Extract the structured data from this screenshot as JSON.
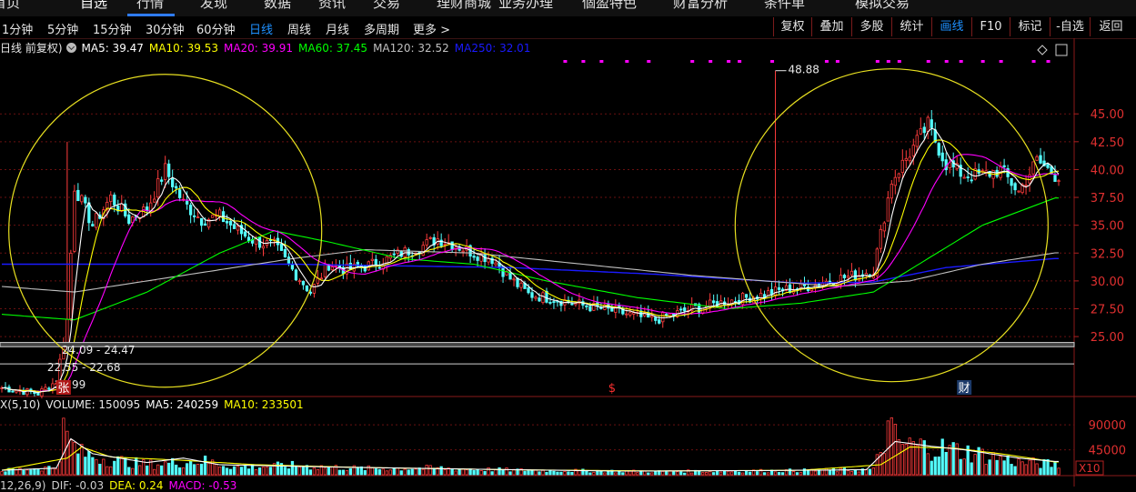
{
  "top_nav": {
    "items": [
      {
        "label": "首页",
        "active": false
      },
      {
        "label": "自选",
        "active": true
      },
      {
        "label": "行情",
        "active": false
      },
      {
        "label": "发现",
        "active": false
      },
      {
        "label": "数据",
        "active": false
      },
      {
        "label": "资讯",
        "active": false
      },
      {
        "label": "交易",
        "active": false
      },
      {
        "label": "理财商城",
        "active": false
      },
      {
        "label": "业务办理",
        "active": false
      },
      {
        "label": "個盈特色",
        "active": false
      },
      {
        "label": "财富分析",
        "active": false
      },
      {
        "label": "条件单",
        "active": false
      },
      {
        "label": "模拟交易",
        "active": false
      }
    ]
  },
  "toolbar": {
    "periods": [
      {
        "label": "1分钟",
        "active": false
      },
      {
        "label": "5分钟",
        "active": false
      },
      {
        "label": "15分钟",
        "active": false
      },
      {
        "label": "30分钟",
        "active": false
      },
      {
        "label": "60分钟",
        "active": false
      },
      {
        "label": "日线",
        "active": true
      },
      {
        "label": "周线",
        "active": false
      },
      {
        "label": "月线",
        "active": false
      },
      {
        "label": "多周期",
        "active": false
      },
      {
        "label": "更多 >",
        "active": false
      }
    ],
    "buttons": [
      {
        "label": "复权",
        "active": false
      },
      {
        "label": "叠加",
        "active": false
      },
      {
        "label": "多股",
        "active": false
      },
      {
        "label": "统计",
        "active": false
      },
      {
        "label": "画线",
        "active": true
      },
      {
        "label": "F10",
        "active": false
      },
      {
        "label": "标记",
        "active": false
      },
      {
        "label": "-自选",
        "active": false
      },
      {
        "label": "返回",
        "active": false
      }
    ]
  },
  "legend": {
    "kline_label": "日线 前复权)",
    "ma5": "MA5: 39.47",
    "ma10": "MA10: 39.53",
    "ma20": "MA20: 39.91",
    "ma60": "MA60: 37.45",
    "ma120": "MA120: 32.52",
    "ma250": "MA250: 32.01"
  },
  "volume_legend": {
    "name": "X(5,10)",
    "volume": "VOLUME: 150095",
    "ma5": "MA5: 240259",
    "ma10": "MA10: 233501"
  },
  "macd_legend": {
    "name": "12,26,9)",
    "dif": "DIF: -0.03",
    "dea": "DEA: 0.24",
    "macd": "MACD: -0.53"
  },
  "colors": {
    "up": "#ff3c3c",
    "down": "#54ffff",
    "ma5": "#ffffff",
    "ma10": "#ffff00",
    "ma20": "#ff00ff",
    "ma60": "#00ff00",
    "ma120": "#c0c0c0",
    "ma250": "#1a1aff",
    "grid": "#6a1010",
    "circle": "#e8e020",
    "axis_text": "#e03030"
  },
  "chart_data": [
    {
      "type": "candlestick",
      "title": "日线",
      "y_ticks": [
        25.0,
        27.5,
        30.0,
        32.5,
        35.0,
        37.5,
        40.0,
        42.5,
        45.0
      ],
      "y_tick_labels": [
        "25.00",
        "27.50",
        "30.00",
        "32.50",
        "35.00",
        "37.50",
        "40.00",
        "42.50",
        "45.00"
      ],
      "ylim": [
        19.7,
        50.0
      ],
      "grid": true,
      "price_annotations": [
        {
          "label": "48.88",
          "x_index": 213,
          "price": 48.88
        },
        {
          "label": "24.09 - 24.47",
          "x_index": 18,
          "price": 24.09
        },
        {
          "label": "22.55 - 22.68",
          "x_index": 14,
          "price": 22.55
        },
        {
          "label": "20.99",
          "x_index": 16,
          "price": 20.99
        }
      ],
      "horizontal_bands": [
        24.09,
        24.47,
        22.55
      ],
      "event_markers": [
        {
          "label": "张",
          "x_index": 17
        },
        {
          "label": "$",
          "x_index": 168
        },
        {
          "label": "财",
          "x_index": 265
        }
      ],
      "signal_dots_x": [
        155,
        160,
        165,
        172,
        178,
        190,
        195,
        200,
        203,
        212,
        227,
        230,
        241,
        244,
        247,
        255,
        260,
        264,
        270,
        275,
        284,
        288
      ],
      "highlight_circles": [
        {
          "center_x_index": 45,
          "center_price": 34.5
        },
        {
          "center_x_index": 245,
          "center_price": 35.0
        }
      ],
      "keypoints": [
        [
          0,
          20.4
        ],
        [
          10,
          19.9
        ],
        [
          15,
          20.99
        ],
        [
          18,
          26.5
        ],
        [
          20,
          38.5
        ],
        [
          25,
          35.0
        ],
        [
          30,
          37.5
        ],
        [
          35,
          35.5
        ],
        [
          40,
          36.5
        ],
        [
          45,
          40.0
        ],
        [
          50,
          37.0
        ],
        [
          55,
          35.5
        ],
        [
          60,
          35.8
        ],
        [
          65,
          34.5
        ],
        [
          70,
          33.5
        ],
        [
          75,
          33.2
        ],
        [
          80,
          31.0
        ],
        [
          85,
          29.0
        ],
        [
          90,
          31.5
        ],
        [
          95,
          31.0
        ],
        [
          100,
          31.3
        ],
        [
          105,
          31.8
        ],
        [
          110,
          32.5
        ],
        [
          115,
          33.0
        ],
        [
          120,
          33.8
        ],
        [
          125,
          33.2
        ],
        [
          130,
          32.5
        ],
        [
          135,
          32.0
        ],
        [
          140,
          30.2
        ],
        [
          145,
          28.8
        ],
        [
          150,
          28.5
        ],
        [
          155,
          28.2
        ],
        [
          160,
          27.8
        ],
        [
          165,
          27.5
        ],
        [
          170,
          27.2
        ],
        [
          175,
          26.8
        ],
        [
          180,
          26.5
        ],
        [
          185,
          27.0
        ],
        [
          190,
          27.5
        ],
        [
          195,
          27.8
        ],
        [
          200,
          28.2
        ],
        [
          205,
          28.5
        ],
        [
          210,
          28.8
        ],
        [
          215,
          29.2
        ],
        [
          220,
          29.4
        ],
        [
          225,
          29.8
        ],
        [
          230,
          30.2
        ],
        [
          235,
          30.5
        ],
        [
          240,
          31.0
        ],
        [
          245,
          39.0
        ],
        [
          250,
          41.5
        ],
        [
          255,
          44.0
        ],
        [
          260,
          40.5
        ],
        [
          265,
          39.5
        ],
        [
          270,
          39.5
        ],
        [
          275,
          40.0
        ],
        [
          280,
          38.0
        ],
        [
          285,
          40.8
        ],
        [
          290,
          39.5
        ]
      ],
      "moving_averages": {
        "ma5": "MA5: 39.47",
        "ma10": "MA10: 39.53",
        "ma20": "MA20: 39.91",
        "ma60": "MA60: 37.45",
        "ma120": "MA120: 32.52",
        "ma250": "MA250: 32.01",
        "ma60_keypoints": [
          [
            0,
            27.0
          ],
          [
            20,
            26.5
          ],
          [
            40,
            29.0
          ],
          [
            60,
            32.5
          ],
          [
            75,
            34.5
          ],
          [
            90,
            33.5
          ],
          [
            110,
            32.0
          ],
          [
            130,
            31.5
          ],
          [
            150,
            30.0
          ],
          [
            175,
            28.5
          ],
          [
            200,
            27.5
          ],
          [
            220,
            28.0
          ],
          [
            240,
            29.0
          ],
          [
            250,
            31.0
          ],
          [
            270,
            35.0
          ],
          [
            290,
            37.45
          ]
        ],
        "ma120_keypoints": [
          [
            0,
            29.5
          ],
          [
            20,
            29.0
          ],
          [
            40,
            30.0
          ],
          [
            60,
            31.0
          ],
          [
            80,
            32.0
          ],
          [
            100,
            32.8
          ],
          [
            130,
            32.5
          ],
          [
            160,
            31.5
          ],
          [
            190,
            30.5
          ],
          [
            210,
            30.0
          ],
          [
            230,
            29.5
          ],
          [
            250,
            30.0
          ],
          [
            270,
            31.5
          ],
          [
            290,
            32.52
          ]
        ],
        "ma250_keypoints": [
          [
            0,
            31.5
          ],
          [
            80,
            31.5
          ],
          [
            140,
            31.2
          ],
          [
            180,
            30.6
          ],
          [
            220,
            29.8
          ],
          [
            240,
            29.9
          ],
          [
            260,
            31.2
          ],
          [
            290,
            32.01
          ]
        ]
      }
    },
    {
      "type": "bar",
      "title": "VOLUME",
      "y_tick_labels": [
        "90000",
        "45000",
        "X10"
      ],
      "y_ticks": [
        90000,
        45000
      ],
      "ylim": [
        0,
        110000
      ],
      "keypoints": [
        [
          0,
          8000
        ],
        [
          15,
          15000
        ],
        [
          17,
          85000
        ],
        [
          19,
          62000
        ],
        [
          22,
          42000
        ],
        [
          30,
          30000
        ],
        [
          40,
          20000
        ],
        [
          50,
          25000
        ],
        [
          55,
          28000
        ],
        [
          65,
          15000
        ],
        [
          80,
          18000
        ],
        [
          100,
          12000
        ],
        [
          120,
          13000
        ],
        [
          140,
          9000
        ],
        [
          160,
          7500
        ],
        [
          180,
          6000
        ],
        [
          200,
          7000
        ],
        [
          220,
          8000
        ],
        [
          240,
          10000
        ],
        [
          244,
          88000
        ],
        [
          248,
          60000
        ],
        [
          255,
          55000
        ],
        [
          262,
          50000
        ],
        [
          270,
          40000
        ],
        [
          280,
          25000
        ],
        [
          290,
          20000
        ]
      ],
      "volume_ma5_keypoints": [
        [
          0,
          8000
        ],
        [
          15,
          12000
        ],
        [
          19,
          65000
        ],
        [
          25,
          38000
        ],
        [
          40,
          22000
        ],
        [
          50,
          30000
        ],
        [
          60,
          18000
        ],
        [
          90,
          14000
        ],
        [
          130,
          10000
        ],
        [
          170,
          6500
        ],
        [
          210,
          7500
        ],
        [
          238,
          9000
        ],
        [
          246,
          60000
        ],
        [
          255,
          52000
        ],
        [
          265,
          45000
        ],
        [
          280,
          30000
        ],
        [
          290,
          24000
        ]
      ],
      "volume_ma10_keypoints": [
        [
          0,
          8000
        ],
        [
          18,
          30000
        ],
        [
          22,
          50000
        ],
        [
          30,
          32000
        ],
        [
          50,
          26000
        ],
        [
          70,
          18000
        ],
        [
          100,
          13000
        ],
        [
          140,
          9000
        ],
        [
          180,
          6800
        ],
        [
          220,
          8000
        ],
        [
          242,
          18000
        ],
        [
          250,
          50000
        ],
        [
          262,
          48000
        ],
        [
          275,
          38000
        ],
        [
          290,
          23000
        ]
      ]
    }
  ]
}
